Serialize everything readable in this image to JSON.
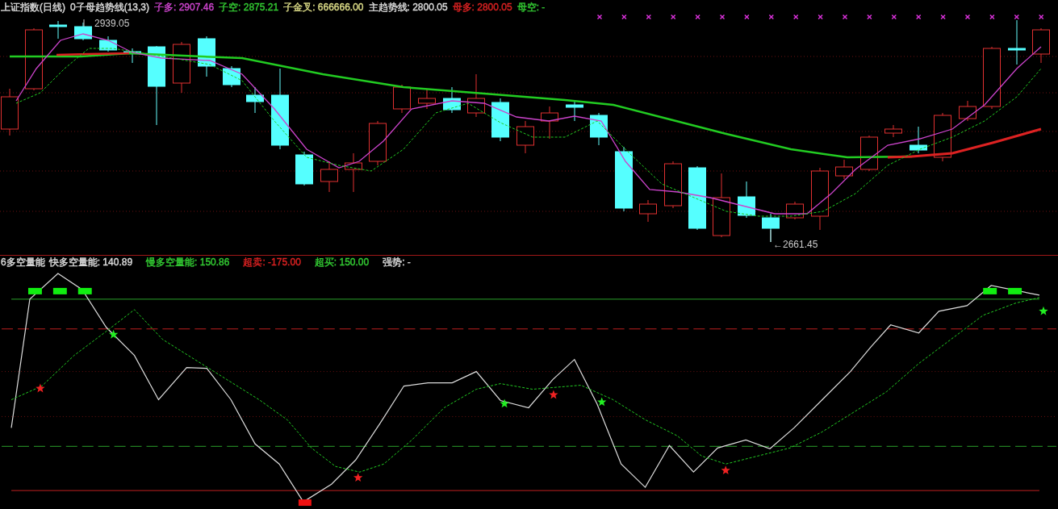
{
  "main_panel": {
    "title": "上证指数(日线)",
    "indicator": "0子母趋势线(13,3)",
    "legend": [
      {
        "text": "子多: 2907.46",
        "color": "#cc44cc"
      },
      {
        "text": "子空: 2875.21",
        "color": "#33cc33"
      },
      {
        "text": "子金叉: 666666.00",
        "color": "#dddd88"
      },
      {
        "text": "主趋势线: 2800.05",
        "color": "#dddddd"
      },
      {
        "text": "母多: 2800.05",
        "color": "#dd2222"
      },
      {
        "text": "母空: -",
        "color": "#33cc33"
      }
    ],
    "annotations": [
      "2939.05",
      "←2661.45"
    ]
  },
  "sub_panel": {
    "title": "6多空量能",
    "legend": [
      {
        "text": "快多空量能: 140.89",
        "color": "#dddddd"
      },
      {
        "text": "慢多空量能: 150.86",
        "color": "#33cc33"
      },
      {
        "text": "超卖: -175.00",
        "color": "#dd2222"
      },
      {
        "text": "超买: 150.00",
        "color": "#33cc33"
      },
      {
        "text": "强势: -",
        "color": "#dddddd"
      }
    ]
  }
}
